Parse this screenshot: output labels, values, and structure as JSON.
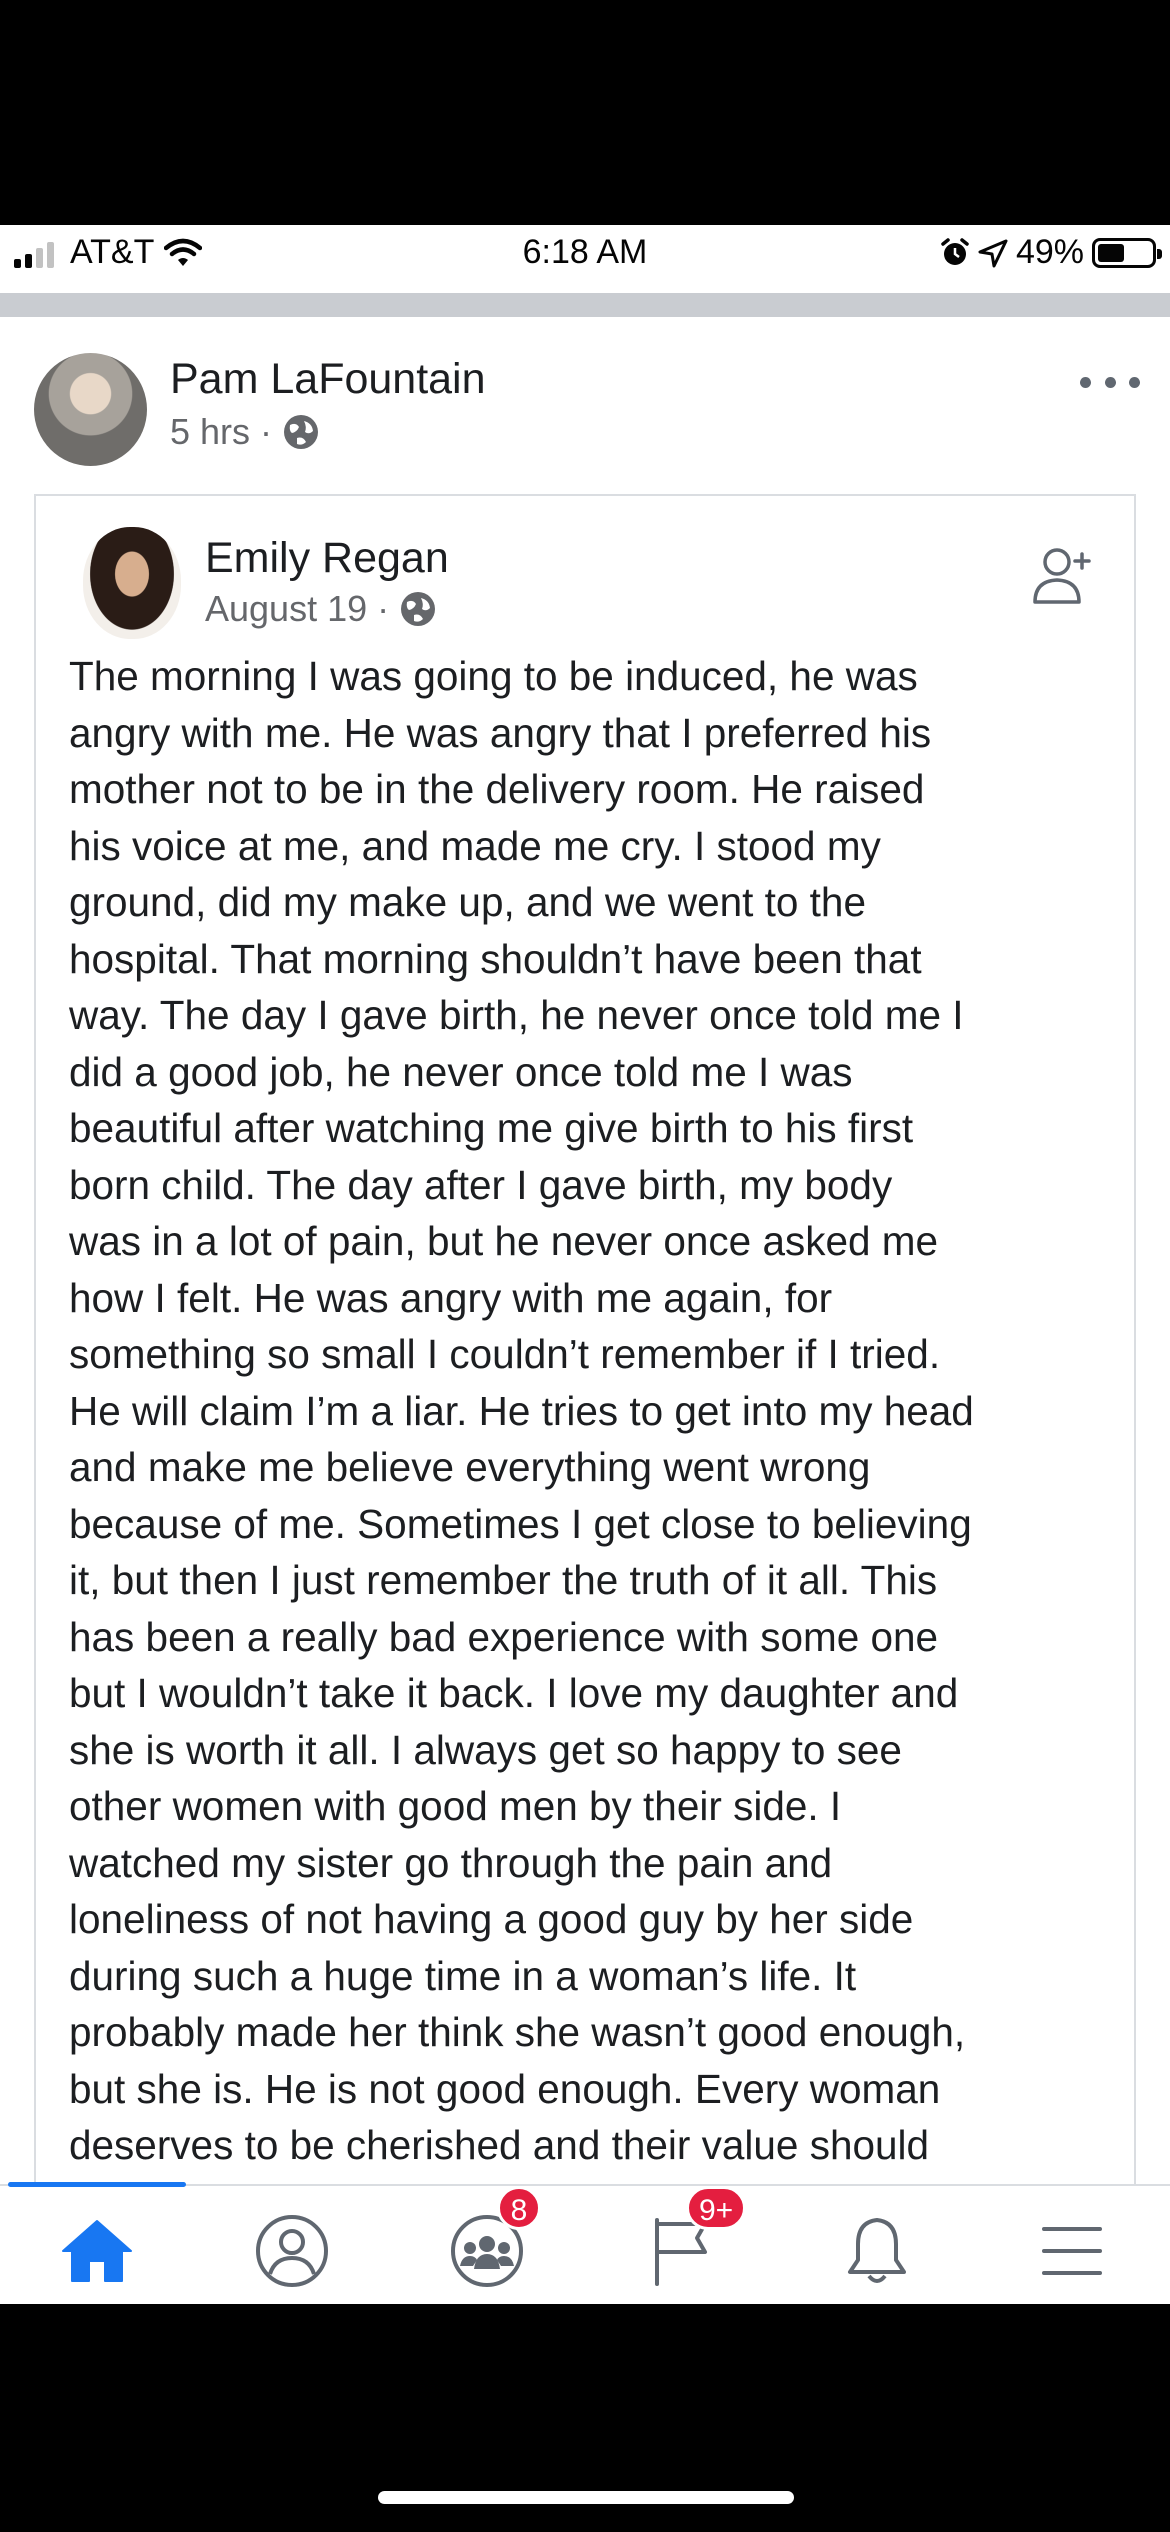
{
  "status_bar": {
    "carrier": "AT&T",
    "time": "6:18 AM",
    "battery": "49%",
    "battery_level": 0.49,
    "signal_bars": 2,
    "icons": [
      "signal-icon",
      "wifi-icon",
      "alarm-icon",
      "location-arrow-icon",
      "battery-icon"
    ]
  },
  "post": {
    "author": "Pam LaFountain",
    "time": "5 hrs",
    "separator": "·",
    "audience_icon": "globe-icon",
    "more_icon": "more-dots-icon"
  },
  "shared_post": {
    "author": "Emily Regan",
    "date": "August 19",
    "separator": "·",
    "audience_icon": "globe-icon",
    "action_icon": "add-friend-icon",
    "body_lines": [
      "The morning I was going to be induced, he was",
      "angry with me. He was angry that I preferred his",
      "mother not to be in the delivery room. He raised",
      "his voice at me, and made me cry. I stood my",
      "ground, did my make up, and we went to the",
      "hospital. That morning shouldn’t have been that",
      "way. The day I gave birth, he never once told me I",
      "did a good job, he never once told me I was",
      "beautiful after watching me give birth to his first",
      "born child. The day after I gave birth, my body",
      "was in a lot of pain, but he never once asked me",
      "how I felt. He was angry with me again, for",
      "something so small I couldn’t remember if I tried.",
      "He will claim I’m a liar. He tries to get into my head",
      "and make me believe everything went wrong",
      "because of me. Sometimes I get close to believing",
      "it, but then I just remember the truth of it all. This",
      "has been a really bad experience with some one",
      "but I wouldn’t take it back. I love my daughter and",
      "she is worth it all. I always get so happy to see",
      "other women with good men by their side. I",
      "watched my sister go through the pain and",
      "loneliness of not having a good guy by her side",
      "during such a huge time in a woman’s life. It",
      "probably made her think she wasn’t good enough,",
      "but she is. He is not good enough. Every woman",
      "deserves to be cherished and their value should"
    ]
  },
  "bottom_nav": {
    "items": [
      {
        "icon": "home-icon",
        "active": true
      },
      {
        "icon": "profile-icon",
        "active": false
      },
      {
        "icon": "groups-icon",
        "badge": "8",
        "active": false
      },
      {
        "icon": "pages-flag-icon",
        "badge": "9+",
        "active": false
      },
      {
        "icon": "notifications-bell-icon",
        "active": false
      },
      {
        "icon": "menu-icon",
        "active": false
      }
    ]
  },
  "colors": {
    "accent": "#1877f2",
    "badge": "#e41e3f",
    "text": "#1c1e21",
    "secondary_text": "#65676b",
    "separator": "#c9ccd1"
  }
}
